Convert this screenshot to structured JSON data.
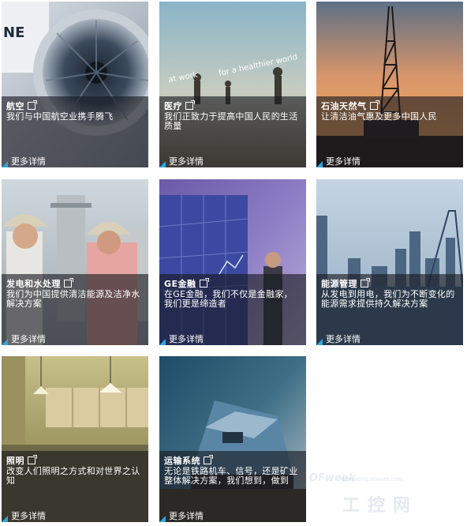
{
  "tiles": [
    {
      "title": "航空",
      "desc": "我们与中国航空业携手腾飞",
      "more": "更多详情"
    },
    {
      "title": "医疗",
      "desc": "我们正致力于提高中国人民的生活质量",
      "more": "更多详情",
      "photo_text_1": "at work",
      "photo_text_2": "for a healthier world"
    },
    {
      "title": "石油天然气",
      "desc": "让清洁油气惠及更多中国人民",
      "more": "更多详情"
    },
    {
      "title": "发电和水处理",
      "desc": "我们为中国提供清洁能源及洁净水解决方案",
      "more": "更多详情"
    },
    {
      "title": "GE金融",
      "desc": "在GE金融，我们不仅是金融家，我们更是缔造者",
      "more": "更多详情"
    },
    {
      "title": "能源管理",
      "desc": "从发电到用电，我们为不断变化的能源需求提供持久解决方案",
      "more": "更多详情"
    },
    {
      "title": "照明",
      "desc": "改变人们照明之方式和对世界之认知",
      "more": "更多详情"
    },
    {
      "title": "运输系统",
      "desc": "无论是铁路机车、信号，还是矿业整体解决方案，我们想到，做到",
      "more": "更多详情"
    }
  ],
  "watermark": {
    "brand": "OFweek",
    "cn": "工控网",
    "small": "gongkong.ofweek.com"
  },
  "colors": {
    "overlay": "#19191e",
    "more_triangle": "#2aa6e0"
  }
}
